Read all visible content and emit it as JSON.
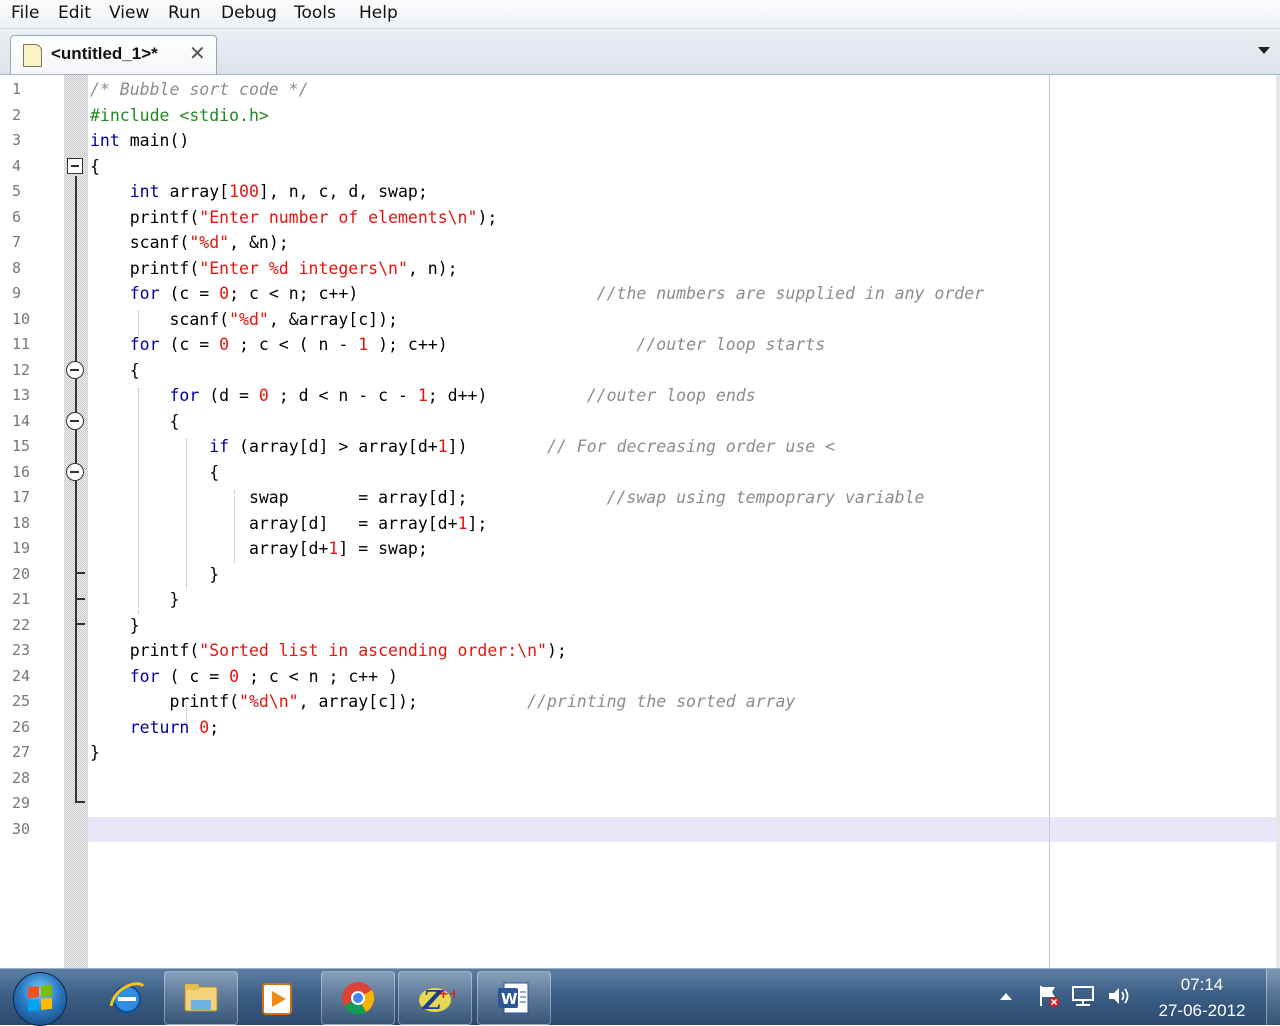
{
  "menu": [
    "File",
    "Edit",
    "View",
    "Run",
    "Debug",
    "Tools",
    "Help"
  ],
  "tab": {
    "label": "<untitled_1>*",
    "close": "✕"
  },
  "line_numbers": [
    "1",
    "2",
    "3",
    "4",
    "5",
    "6",
    "7",
    "8",
    "9",
    "10",
    "11",
    "12",
    "13",
    "14",
    "15",
    "16",
    "17",
    "18",
    "19",
    "20",
    "21",
    "22",
    "23",
    "24",
    "25",
    "26",
    "27",
    "28",
    "29",
    "30"
  ],
  "code": [
    [
      [
        "cm",
        "/* Bubble sort code */"
      ]
    ],
    [
      [
        "pp",
        "#include <stdio.h>"
      ]
    ],
    [
      [
        "kw",
        "int"
      ],
      [
        "t",
        " main()"
      ]
    ],
    [
      [
        "t",
        "{"
      ]
    ],
    [
      [
        "t",
        "    "
      ],
      [
        "kw",
        "int"
      ],
      [
        "t",
        " array["
      ],
      [
        "num",
        "100"
      ],
      [
        "t",
        "], n, c, d, swap;"
      ]
    ],
    [
      [
        "t",
        "    printf("
      ],
      [
        "str",
        "\"Enter number of elements\\n\""
      ],
      [
        "t",
        ");"
      ]
    ],
    [
      [
        "t",
        "    scanf("
      ],
      [
        "str",
        "\"%d\""
      ],
      [
        "t",
        ", &n);"
      ]
    ],
    [
      [
        "t",
        "    printf("
      ],
      [
        "str",
        "\"Enter %d integers\\n\""
      ],
      [
        "t",
        ", n);"
      ]
    ],
    [
      [
        "t",
        "    "
      ],
      [
        "kw",
        "for"
      ],
      [
        "t",
        " (c = "
      ],
      [
        "num",
        "0"
      ],
      [
        "t",
        "; c < n; c++)                        "
      ],
      [
        "cm",
        "//the numbers are supplied in any order"
      ]
    ],
    [
      [
        "t",
        "        scanf("
      ],
      [
        "str",
        "\"%d\""
      ],
      [
        "t",
        ", &array[c]);"
      ]
    ],
    [
      [
        "t",
        "    "
      ],
      [
        "kw",
        "for"
      ],
      [
        "t",
        " (c = "
      ],
      [
        "num",
        "0"
      ],
      [
        "t",
        " ; c < ( n - "
      ],
      [
        "num",
        "1"
      ],
      [
        "t",
        " ); c++)                   "
      ],
      [
        "cm",
        "//outer loop starts"
      ]
    ],
    [
      [
        "t",
        "    {"
      ]
    ],
    [
      [
        "t",
        "        "
      ],
      [
        "kw",
        "for"
      ],
      [
        "t",
        " (d = "
      ],
      [
        "num",
        "0"
      ],
      [
        "t",
        " ; d < n - c - "
      ],
      [
        "num",
        "1"
      ],
      [
        "t",
        "; d++)          "
      ],
      [
        "cm",
        "//outer loop ends"
      ]
    ],
    [
      [
        "t",
        "        {"
      ]
    ],
    [
      [
        "t",
        "            "
      ],
      [
        "kw",
        "if"
      ],
      [
        "t",
        " (array[d] > array[d+"
      ],
      [
        "num",
        "1"
      ],
      [
        "t",
        "])        "
      ],
      [
        "cm",
        "// For decreasing order use <"
      ]
    ],
    [
      [
        "t",
        "            {"
      ]
    ],
    [
      [
        "t",
        "                swap       = array[d];              "
      ],
      [
        "cm",
        "//swap using tempoprary variable"
      ]
    ],
    [
      [
        "t",
        "                array[d]   = array[d+"
      ],
      [
        "num",
        "1"
      ],
      [
        "t",
        "];"
      ]
    ],
    [
      [
        "t",
        "                array[d+"
      ],
      [
        "num",
        "1"
      ],
      [
        "t",
        "] = swap;"
      ]
    ],
    [
      [
        "t",
        "            }"
      ]
    ],
    [
      [
        "t",
        "        }"
      ]
    ],
    [
      [
        "t",
        "    }"
      ]
    ],
    [
      [
        "t",
        "    printf("
      ],
      [
        "str",
        "\"Sorted list in ascending order:\\n\""
      ],
      [
        "t",
        ");"
      ]
    ],
    [
      [
        "t",
        "    "
      ],
      [
        "kw",
        "for"
      ],
      [
        "t",
        " ( c = "
      ],
      [
        "num",
        "0"
      ],
      [
        "t",
        " ; c < n ; c++ )"
      ]
    ],
    [
      [
        "t",
        "        printf("
      ],
      [
        "str",
        "\"%d\\n\""
      ],
      [
        "t",
        ", array[c]);           "
      ],
      [
        "cm",
        "//printing the sorted array"
      ]
    ],
    [
      [
        "t",
        "    "
      ],
      [
        "kw",
        "return"
      ],
      [
        "t",
        " "
      ],
      [
        "num",
        "0"
      ],
      [
        "t",
        ";"
      ]
    ],
    [
      [
        "t",
        "}"
      ]
    ],
    [],
    [],
    []
  ],
  "taskbar": {
    "apps": [
      "internet-explorer-icon",
      "windows-explorer-icon",
      "media-player-icon",
      "chrome-icon",
      "z-plus-plus-icon",
      "word-icon"
    ],
    "clock_time": "07:14",
    "clock_date": "27-06-2012"
  },
  "colors": {
    "keyword": "#0000a0",
    "string": "#e8130e",
    "preprocessor": "#1f8a1f",
    "comment": "#8c8c8c",
    "current_line": "#e8e8fa"
  }
}
